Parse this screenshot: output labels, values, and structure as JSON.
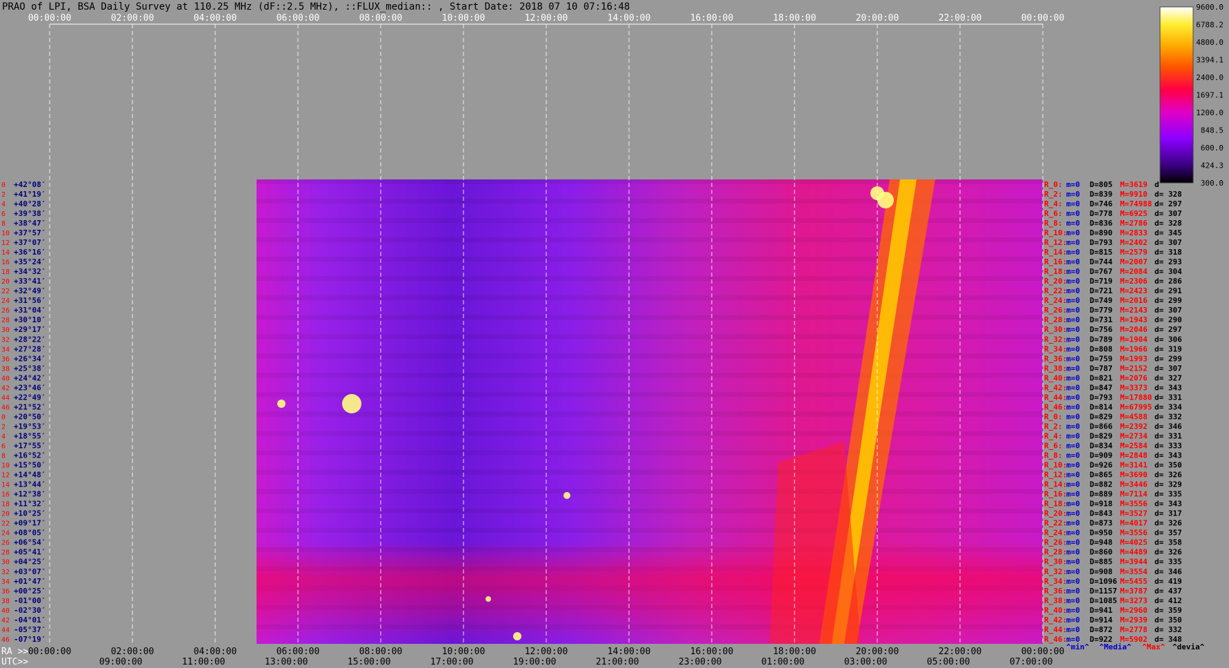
{
  "header": {
    "title": "PRAO of LPI, BSA Daily Survey at 110.25 MHz (dF::2.5 MHz), ::FLUX_median:: , Start Date: 2018 07 10 07:16:48"
  },
  "chart_data": {
    "type": "heatmap",
    "colormap": [
      "#000000",
      "#3a0080",
      "#8a00ff",
      "#e000c8",
      "#ff0044",
      "#ff5500",
      "#ffaa00",
      "#ffee33",
      "#ffffff"
    ],
    "colorbar": {
      "ticks": [
        {
          "value": 9600.0,
          "label": "9600.0"
        },
        {
          "value": 6788.2,
          "label": "6788.2"
        },
        {
          "value": 4800.0,
          "label": "4800.0"
        },
        {
          "value": 3394.1,
          "label": "3394.1"
        },
        {
          "value": 2400.0,
          "label": "2400.0"
        },
        {
          "value": 1697.1,
          "label": "1697.1"
        },
        {
          "value": 1200.0,
          "label": "1200.0"
        },
        {
          "value": 848.5,
          "label": "848.5"
        },
        {
          "value": 600.0,
          "label": "600.0"
        },
        {
          "value": 424.3,
          "label": "424.3"
        },
        {
          "value": 300.0,
          "label": "300.0"
        }
      ]
    },
    "top_axis": {
      "range_hours": [
        0,
        24
      ],
      "ticks": [
        "00:00:00",
        "02:00:00",
        "04:00:00",
        "06:00:00",
        "08:00:00",
        "10:00:00",
        "12:00:00",
        "14:00:00",
        "16:00:00",
        "18:00:00",
        "20:00:00",
        "22:00:00",
        "00:00:00"
      ]
    },
    "bottom_axes": {
      "ra_prefix": "RA >>",
      "ra_ticks": [
        "00:00:00",
        "02:00:00",
        "04:00:00",
        "06:00:00",
        "08:00:00",
        "10:00:00",
        "12:00:00",
        "14:00:00",
        "16:00:00",
        "18:00:00",
        "20:00:00",
        "22:00:00",
        "00:00:00"
      ],
      "utc_prefix": "UTC>>",
      "utc_ticks": [
        "09:00:00",
        "11:00:00",
        "13:00:00",
        "15:00:00",
        "17:00:00",
        "19:00:00",
        "21:00:00",
        "23:00:00",
        "01:00:00",
        "03:00:00",
        "05:00:00",
        "07:00:00"
      ],
      "utc_tick_hours": [
        1.72,
        3.72,
        5.72,
        7.72,
        9.72,
        11.72,
        13.72,
        15.72,
        17.72,
        19.72,
        21.72,
        23.72
      ]
    },
    "data_start_hour": 5.0,
    "data_end_hour": 24.0,
    "rows": [
      {
        "idx": "0",
        "dec": "+42°08′",
        "stat": {
          "r": "R_0:",
          "m": "m=0",
          "d": "D=805",
          "M": "M=3619",
          "dev": "d"
        }
      },
      {
        "idx": "2",
        "dec": "+41°19′",
        "stat": {
          "r": "R_2:",
          "m": "m=0",
          "d": "D=839",
          "M": "M=9910",
          "dev": "d= 328"
        }
      },
      {
        "idx": "4",
        "dec": "+40°28′",
        "stat": {
          "r": "R_4:",
          "m": "m=0",
          "d": "D=746",
          "M": "M=74988",
          "dev": "d= 297"
        }
      },
      {
        "idx": "6",
        "dec": "+39°38′",
        "stat": {
          "r": "R_6:",
          "m": "m=0",
          "d": "D=778",
          "M": "M=6925",
          "dev": "d= 307"
        }
      },
      {
        "idx": "8",
        "dec": "+38°47′",
        "stat": {
          "r": "R_8:",
          "m": "m=0",
          "d": "D=836",
          "M": "M=2786",
          "dev": "d= 328"
        }
      },
      {
        "idx": "10",
        "dec": "+37°57′",
        "stat": {
          "r": "R_10:",
          "m": "m=0",
          "d": "D=890",
          "M": "M=2833",
          "dev": "d= 345"
        }
      },
      {
        "idx": "12",
        "dec": "+37°07′",
        "stat": {
          "r": "R_12:",
          "m": "m=0",
          "d": "D=793",
          "M": "M=2402",
          "dev": "d= 307"
        }
      },
      {
        "idx": "14",
        "dec": "+36°16′",
        "stat": {
          "r": "R_14:",
          "m": "m=0",
          "d": "D=815",
          "M": "M=2579",
          "dev": "d= 318"
        }
      },
      {
        "idx": "16",
        "dec": "+35°24′",
        "stat": {
          "r": "R_16:",
          "m": "m=0",
          "d": "D=744",
          "M": "M=2007",
          "dev": "d= 293"
        }
      },
      {
        "idx": "18",
        "dec": "+34°32′",
        "stat": {
          "r": "R_18:",
          "m": "m=0",
          "d": "D=767",
          "M": "M=2084",
          "dev": "d= 304"
        }
      },
      {
        "idx": "20",
        "dec": "+33°41′",
        "stat": {
          "r": "R_20:",
          "m": "m=0",
          "d": "D=719",
          "M": "M=2306",
          "dev": "d= 286"
        }
      },
      {
        "idx": "22",
        "dec": "+32°49′",
        "stat": {
          "r": "R_22:",
          "m": "m=0",
          "d": "D=721",
          "M": "M=2423",
          "dev": "d= 291"
        }
      },
      {
        "idx": "24",
        "dec": "+31°56′",
        "stat": {
          "r": "R_24:",
          "m": "m=0",
          "d": "D=749",
          "M": "M=2016",
          "dev": "d= 299"
        }
      },
      {
        "idx": "26",
        "dec": "+31°04′",
        "stat": {
          "r": "R_26:",
          "m": "m=0",
          "d": "D=779",
          "M": "M=2143",
          "dev": "d= 307"
        }
      },
      {
        "idx": "28",
        "dec": "+30°10′",
        "stat": {
          "r": "R_28:",
          "m": "m=0",
          "d": "D=731",
          "M": "M=1943",
          "dev": "d= 290"
        }
      },
      {
        "idx": "30",
        "dec": "+29°17′",
        "stat": {
          "r": "R_30:",
          "m": "m=0",
          "d": "D=756",
          "M": "M=2046",
          "dev": "d= 297"
        }
      },
      {
        "idx": "32",
        "dec": "+28°22′",
        "stat": {
          "r": "R_32:",
          "m": "m=0",
          "d": "D=789",
          "M": "M=1904",
          "dev": "d= 306"
        }
      },
      {
        "idx": "34",
        "dec": "+27°28′",
        "stat": {
          "r": "R_34:",
          "m": "m=0",
          "d": "D=808",
          "M": "M=1966",
          "dev": "d= 319"
        }
      },
      {
        "idx": "36",
        "dec": "+26°34′",
        "stat": {
          "r": "R_36:",
          "m": "m=0",
          "d": "D=759",
          "M": "M=1993",
          "dev": "d= 299"
        }
      },
      {
        "idx": "38",
        "dec": "+25°38′",
        "stat": {
          "r": "R_38:",
          "m": "m=0",
          "d": "D=787",
          "M": "M=2152",
          "dev": "d= 307"
        }
      },
      {
        "idx": "40",
        "dec": "+24°42′",
        "stat": {
          "r": "R_40:",
          "m": "m=0",
          "d": "D=821",
          "M": "M=2076",
          "dev": "d= 327"
        }
      },
      {
        "idx": "42",
        "dec": "+23°46′",
        "stat": {
          "r": "R_42:",
          "m": "m=0",
          "d": "D=847",
          "M": "M=3373",
          "dev": "d= 343"
        }
      },
      {
        "idx": "44",
        "dec": "+22°49′",
        "stat": {
          "r": "R_44:",
          "m": "m=0",
          "d": "D=793",
          "M": "M=17880",
          "dev": "d= 331"
        }
      },
      {
        "idx": "46",
        "dec": "+21°52′",
        "stat": {
          "r": "R_46:",
          "m": "m=0",
          "d": "D=814",
          "M": "M=67995",
          "dev": "d= 334"
        }
      },
      {
        "idx": "0",
        "dec": "+20°50′",
        "stat": {
          "r": "R_0:",
          "m": "m=0",
          "d": "D=829",
          "M": "M=4588",
          "dev": "d= 332"
        }
      },
      {
        "idx": "2",
        "dec": "+19°53′",
        "stat": {
          "r": "R_2:",
          "m": "m=0",
          "d": "D=866",
          "M": "M=2392",
          "dev": "d= 346"
        }
      },
      {
        "idx": "4",
        "dec": "+18°55′",
        "stat": {
          "r": "R_4:",
          "m": "m=0",
          "d": "D=829",
          "M": "M=2734",
          "dev": "d= 331"
        }
      },
      {
        "idx": "6",
        "dec": "+17°55′",
        "stat": {
          "r": "R_6:",
          "m": "m=0",
          "d": "D=834",
          "M": "M=2584",
          "dev": "d= 333"
        }
      },
      {
        "idx": "8",
        "dec": "+16°52′",
        "stat": {
          "r": "R_8:",
          "m": "m=0",
          "d": "D=909",
          "M": "M=2848",
          "dev": "d= 343"
        }
      },
      {
        "idx": "10",
        "dec": "+15°50′",
        "stat": {
          "r": "R_10:",
          "m": "m=0",
          "d": "D=926",
          "M": "M=3141",
          "dev": "d= 350"
        }
      },
      {
        "idx": "12",
        "dec": "+14°48′",
        "stat": {
          "r": "R_12:",
          "m": "m=0",
          "d": "D=865",
          "M": "M=3690",
          "dev": "d= 326"
        }
      },
      {
        "idx": "14",
        "dec": "+13°44′",
        "stat": {
          "r": "R_14:",
          "m": "m=0",
          "d": "D=882",
          "M": "M=3446",
          "dev": "d= 329"
        }
      },
      {
        "idx": "16",
        "dec": "+12°38′",
        "stat": {
          "r": "R_16:",
          "m": "m=0",
          "d": "D=889",
          "M": "M=7114",
          "dev": "d= 335"
        }
      },
      {
        "idx": "18",
        "dec": "+11°32′",
        "stat": {
          "r": "R_18:",
          "m": "m=0",
          "d": "D=918",
          "M": "M=3556",
          "dev": "d= 343"
        }
      },
      {
        "idx": "20",
        "dec": "+10°25′",
        "stat": {
          "r": "R_20:",
          "m": "m=0",
          "d": "D=843",
          "M": "M=3527",
          "dev": "d= 317"
        }
      },
      {
        "idx": "22",
        "dec": "+09°17′",
        "stat": {
          "r": "R_22:",
          "m": "m=0",
          "d": "D=873",
          "M": "M=4017",
          "dev": "d= 326"
        }
      },
      {
        "idx": "24",
        "dec": "+08°05′",
        "stat": {
          "r": "R_24:",
          "m": "m=0",
          "d": "D=950",
          "M": "M=3556",
          "dev": "d= 357"
        }
      },
      {
        "idx": "26",
        "dec": "+06°54′",
        "stat": {
          "r": "R_26:",
          "m": "m=0",
          "d": "D=948",
          "M": "M=4025",
          "dev": "d= 358"
        }
      },
      {
        "idx": "28",
        "dec": "+05°41′",
        "stat": {
          "r": "R_28:",
          "m": "m=0",
          "d": "D=860",
          "M": "M=4489",
          "dev": "d= 326"
        }
      },
      {
        "idx": "30",
        "dec": "+04°25′",
        "stat": {
          "r": "R_30:",
          "m": "m=0",
          "d": "D=885",
          "M": "M=3944",
          "dev": "d= 335"
        }
      },
      {
        "idx": "32",
        "dec": "+03°07′",
        "stat": {
          "r": "R_32:",
          "m": "m=0",
          "d": "D=908",
          "M": "M=3554",
          "dev": "d= 346"
        }
      },
      {
        "idx": "34",
        "dec": "+01°47′",
        "stat": {
          "r": "R_34:",
          "m": "m=0",
          "d": "D=1096",
          "M": "M=5455",
          "dev": "d= 419"
        }
      },
      {
        "idx": "36",
        "dec": "+00°25′",
        "stat": {
          "r": "R_36:",
          "m": "m=0",
          "d": "D=1157",
          "M": "M=3787",
          "dev": "d= 437"
        }
      },
      {
        "idx": "38",
        "dec": "-01°00′",
        "stat": {
          "r": "R_38:",
          "m": "m=0",
          "d": "D=1085",
          "M": "M=3273",
          "dev": "d= 412"
        }
      },
      {
        "idx": "40",
        "dec": "-02°30′",
        "stat": {
          "r": "R_40:",
          "m": "m=0",
          "d": "D=941",
          "M": "M=2960",
          "dev": "d= 359"
        }
      },
      {
        "idx": "42",
        "dec": "-04°01′",
        "stat": {
          "r": "R_42:",
          "m": "m=0",
          "d": "D=914",
          "M": "M=2939",
          "dev": "d= 350"
        }
      },
      {
        "idx": "44",
        "dec": "-05°37′",
        "stat": {
          "r": "R_44:",
          "m": "m=0",
          "d": "D=872",
          "M": "M=2778",
          "dev": "d= 332"
        }
      },
      {
        "idx": "46",
        "dec": "-07°19′",
        "stat": {
          "r": "R_46:",
          "m": "m=0",
          "d": "D=922",
          "M": "M=5902",
          "dev": "d= 348"
        }
      }
    ],
    "stats_footer": [
      {
        "label": "^min^",
        "color": "#0000cc"
      },
      {
        "label": "^Media^",
        "color": "#0000cc"
      },
      {
        "label": "^Max^",
        "color": "#ff0000"
      },
      {
        "label": "^devia^",
        "color": "#000000"
      }
    ]
  }
}
